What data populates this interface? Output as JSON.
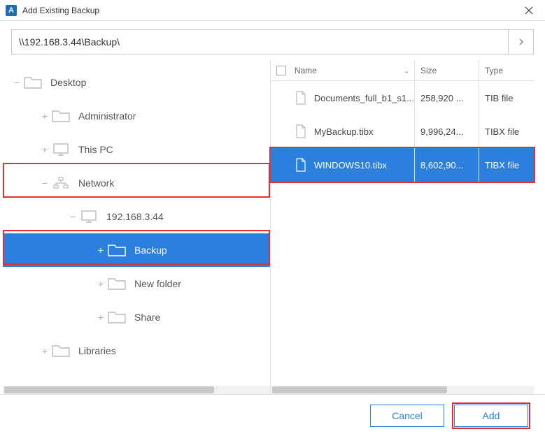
{
  "window": {
    "title": "Add Existing Backup",
    "app_letter": "A"
  },
  "path": {
    "value": "\\\\192.168.3.44\\Backup\\"
  },
  "tree": {
    "desktop": "Desktop",
    "admin": "Administrator",
    "thispc": "This PC",
    "network": "Network",
    "ip": "192.168.3.44",
    "backup": "Backup",
    "newfolder": "New folder",
    "share": "Share",
    "libraries": "Libraries"
  },
  "columns": {
    "name": "Name",
    "size": "Size",
    "type": "Type"
  },
  "files": [
    {
      "name": "Documents_full_b1_s1...",
      "size": "258,920 ...",
      "type": "TIB file"
    },
    {
      "name": "MyBackup.tibx",
      "size": "9,996,24...",
      "type": "TIBX file"
    },
    {
      "name": "WINDOWS10.tibx",
      "size": "8,602,90...",
      "type": "TIBX file"
    }
  ],
  "buttons": {
    "cancel": "Cancel",
    "add": "Add"
  }
}
